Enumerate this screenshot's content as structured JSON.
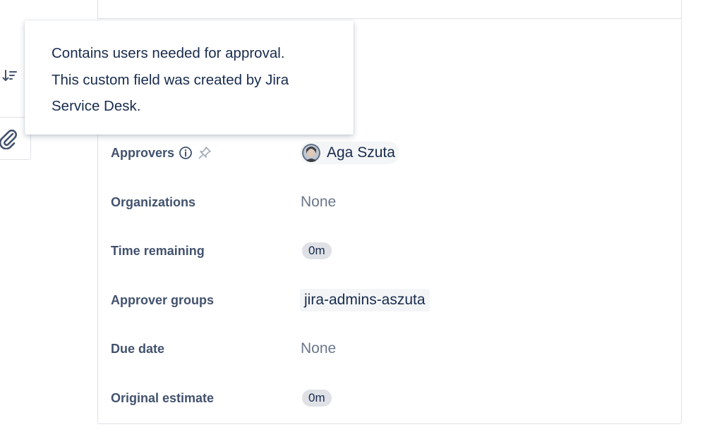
{
  "tooltip": {
    "line1": "Contains users needed for approval.",
    "line2": "This custom field was created by Jira",
    "line3": "Service Desk."
  },
  "fields": {
    "approvers": {
      "label": "Approvers",
      "user": "Aga Szuta"
    },
    "organizations": {
      "label": "Organizations",
      "value": "None"
    },
    "time_remaining": {
      "label": "Time remaining",
      "value": "0m"
    },
    "approver_groups": {
      "label": "Approver groups",
      "value": "jira-admins-aszuta"
    },
    "due_date": {
      "label": "Due date",
      "value": "None"
    },
    "original_estimate": {
      "label": "Original estimate",
      "value": "0m"
    }
  },
  "icons": {
    "sort": "sort-icon",
    "attachment": "paperclip-icon",
    "info": "info-icon",
    "pin": "pin-icon",
    "avatar": "user-avatar"
  },
  "colors": {
    "text": "#172b4d",
    "label": "#42526e",
    "muted": "#6b778c",
    "border": "#dfe1e6",
    "chip_bg": "#f4f5f7",
    "lozenge_bg": "#dfe1e6"
  }
}
